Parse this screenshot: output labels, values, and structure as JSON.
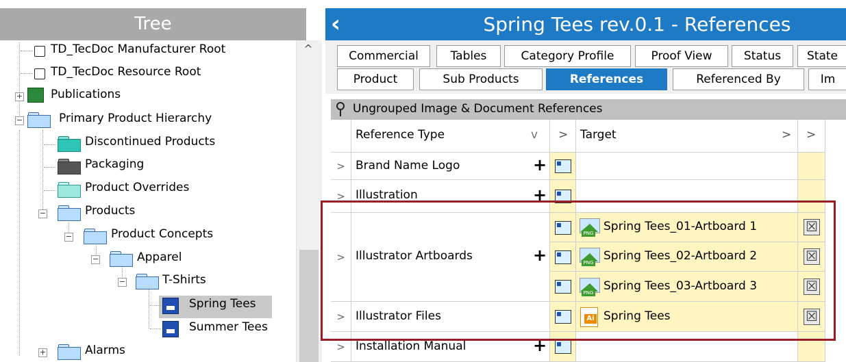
{
  "tree": {
    "header": "Tree",
    "nodes": [
      "TD_TecDoc Manufacturer Root",
      "TD_TecDoc Resource Root",
      "Publications",
      "Primary Product Hierarchy",
      "Discontinued Products",
      "Packaging",
      "Product Overrides",
      "Products",
      "Product Concepts",
      "Apparel",
      "T-Shirts",
      "Spring Tees",
      "Summer Tees",
      "Alarms"
    ],
    "selected": "Spring Tees"
  },
  "window": {
    "title": "Spring Tees rev.0.1 - References",
    "back_icon": "chevron-left-icon"
  },
  "tabs": {
    "row1": [
      "Commercial",
      "Tables",
      "Category Profile",
      "Proof View",
      "Status",
      "State"
    ],
    "row2": [
      "Product",
      "Sub Products",
      "References",
      "Referenced By",
      "Im"
    ],
    "active": "References"
  },
  "group": {
    "label": "Ungrouped Image & Document References"
  },
  "grid": {
    "headers": {
      "reference_type": "Reference Type",
      "target": "Target",
      "expand": ">",
      "dropdown": "v"
    },
    "rows": [
      {
        "type": "Brand Name Logo",
        "targets": []
      },
      {
        "type": "Illustration",
        "targets": []
      },
      {
        "type": "Illustrator Artboards",
        "targets": [
          "Spring Tees_01-Artboard 1",
          "Spring Tees_02-Artboard 2",
          "Spring Tees_03-Artboard 3"
        ]
      },
      {
        "type": "Illustrator Files",
        "targets": [
          "Spring Tees"
        ]
      },
      {
        "type": "Installation Manual",
        "targets": []
      }
    ],
    "row_expander": ">",
    "add_symbol": "+",
    "delete_symbol": "☒"
  },
  "colors": {
    "accent": "#1e7ac4",
    "highlight": "#9a1c24",
    "target_bg": "#fff5c0"
  }
}
